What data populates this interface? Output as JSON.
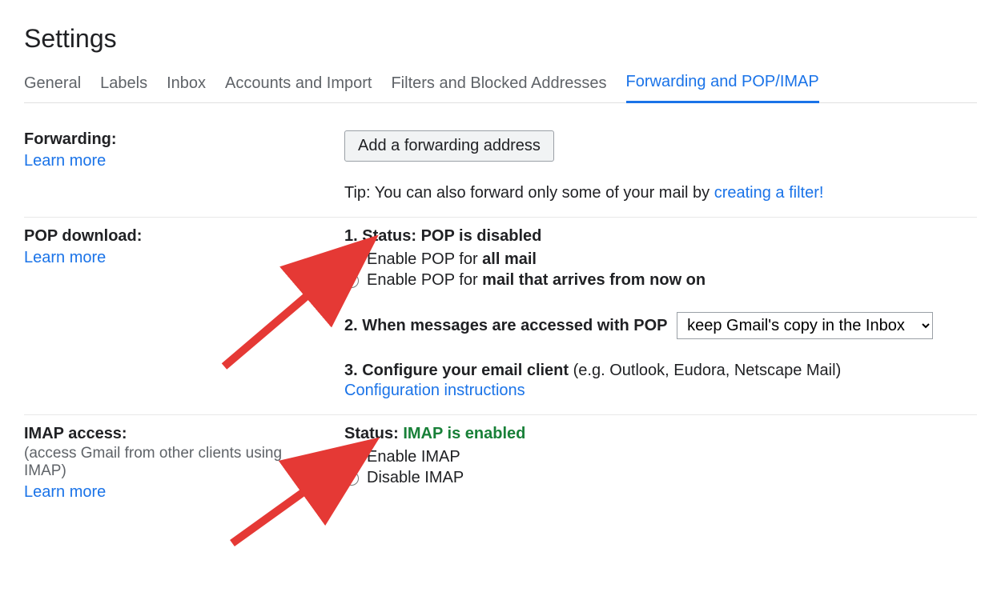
{
  "pageTitle": "Settings",
  "tabs": {
    "general": "General",
    "labels": "Labels",
    "inbox": "Inbox",
    "accounts": "Accounts and Import",
    "filters": "Filters and Blocked Addresses",
    "forwarding": "Forwarding and POP/IMAP"
  },
  "forwarding": {
    "label": "Forwarding:",
    "learnMore": "Learn more",
    "button": "Add a forwarding address",
    "tipPrefix": "Tip: You can also forward only some of your mail by ",
    "tipLink": "creating a filter!"
  },
  "pop": {
    "label": "POP download:",
    "learnMore": "Learn more",
    "statusPrefix": "1. Status: ",
    "statusValue": "POP is disabled",
    "opt1a": "Enable POP for ",
    "opt1b": "all mail",
    "opt2a": "Enable POP for ",
    "opt2b": "mail that arrives from now on",
    "step2Label": "2. When messages are accessed with POP",
    "step2Select": "keep Gmail's copy in the Inbox",
    "step3a": "3. Configure your email client ",
    "step3b": "(e.g. Outlook, Eudora, Netscape Mail)",
    "step3Link": "Configuration instructions"
  },
  "imap": {
    "label": "IMAP access:",
    "sublabel": "(access Gmail from other clients using IMAP)",
    "learnMore": "Learn more",
    "statusPrefix": "Status: ",
    "statusValue": "IMAP is enabled",
    "opt1": "Enable IMAP",
    "opt2": "Disable IMAP"
  }
}
